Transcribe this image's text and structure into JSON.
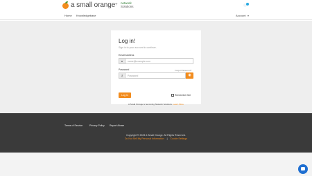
{
  "header": {
    "brand": "a small orange",
    "plus": "+",
    "partner_line1": "network",
    "partner_line2": "Solutions"
  },
  "nav": {
    "home": "Home",
    "knowledgebase": "Knowledgebase",
    "account": "Account",
    "account_caret": "▼"
  },
  "login": {
    "title": "Log in!",
    "subtitle": "Sign in to your account to continue.",
    "email_label": "Email Address",
    "email_placeholder": "name@example.com",
    "password_label": "Password",
    "forgot_label": "Forgot Password?",
    "password_placeholder": "Password",
    "login_button": "Log In",
    "remember_label": "Remember Me"
  },
  "brand_note": {
    "text": "A Small Orange is becoming Network Solutions.",
    "link": "Learn More"
  },
  "footer": {
    "terms": "Terms of Service",
    "privacy": "Privacy Policy",
    "report_abuse": "Report Abuse",
    "copyright": "Copyright © 2023 A Small Orange. All Rights Reserved.",
    "do_not_sell": "Do Not Sell My Personal Information",
    "separator": "|",
    "cookie_settings": "Cookie Settings"
  },
  "colors": {
    "accent": "#f28c1e",
    "footer_bg": "#3a3a3a",
    "chat": "#1f6fd1"
  }
}
